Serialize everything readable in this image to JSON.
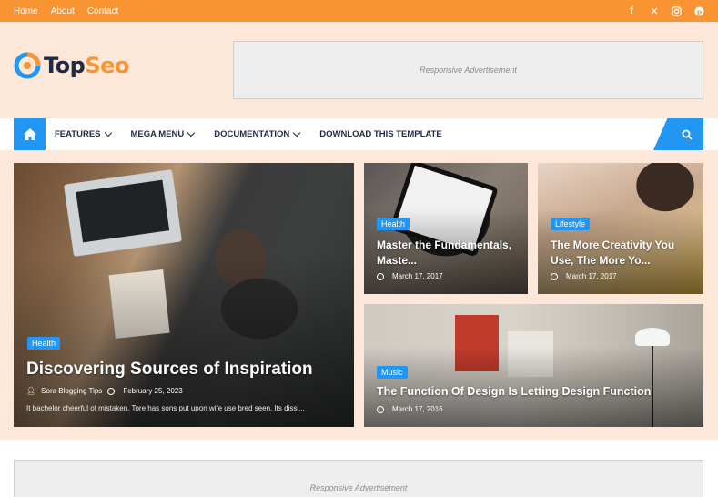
{
  "topbar": {
    "links": [
      "Home",
      "About",
      "Contact"
    ],
    "social_icons": [
      "facebook-icon",
      "x-icon",
      "instagram-icon",
      "pinterest-icon"
    ]
  },
  "header": {
    "logo_text_dark": "Top",
    "logo_text_accent": "Seo",
    "ad_text": "Responsive Advertisement"
  },
  "nav": {
    "items": [
      {
        "label": "FEATURES",
        "dropdown": true
      },
      {
        "label": "MEGA MENU",
        "dropdown": true
      },
      {
        "label": "DOCUMENTATION",
        "dropdown": true
      },
      {
        "label": "DOWNLOAD THIS TEMPLATE",
        "dropdown": false
      }
    ]
  },
  "featured": [
    {
      "tag": "Health",
      "title": "Discovering Sources of Inspiration",
      "author": "Sora Blogging Tips",
      "date": "February 25, 2023",
      "snippet": "It bachelor cheerful of mistaken. Tore has sons put upon wife use bred seen. Its dissi..."
    },
    {
      "tag": "Health",
      "title": "Master the Fundamentals, Maste...",
      "date": "March 17, 2017"
    },
    {
      "tag": "Lifestyle",
      "title": "The More Creativity You Use, The More Yo...",
      "date": "March 17, 2017"
    },
    {
      "tag": "Music",
      "title": "The Function Of Design Is Letting Design Function",
      "date": "March 17, 2016"
    }
  ],
  "bottom_ad": {
    "text": "Responsive Advertisement"
  },
  "colors": {
    "accent_orange": "#fa9432",
    "accent_blue": "#2196f3",
    "page_bg": "#fde7d8",
    "nav_text": "#1f2a44"
  }
}
